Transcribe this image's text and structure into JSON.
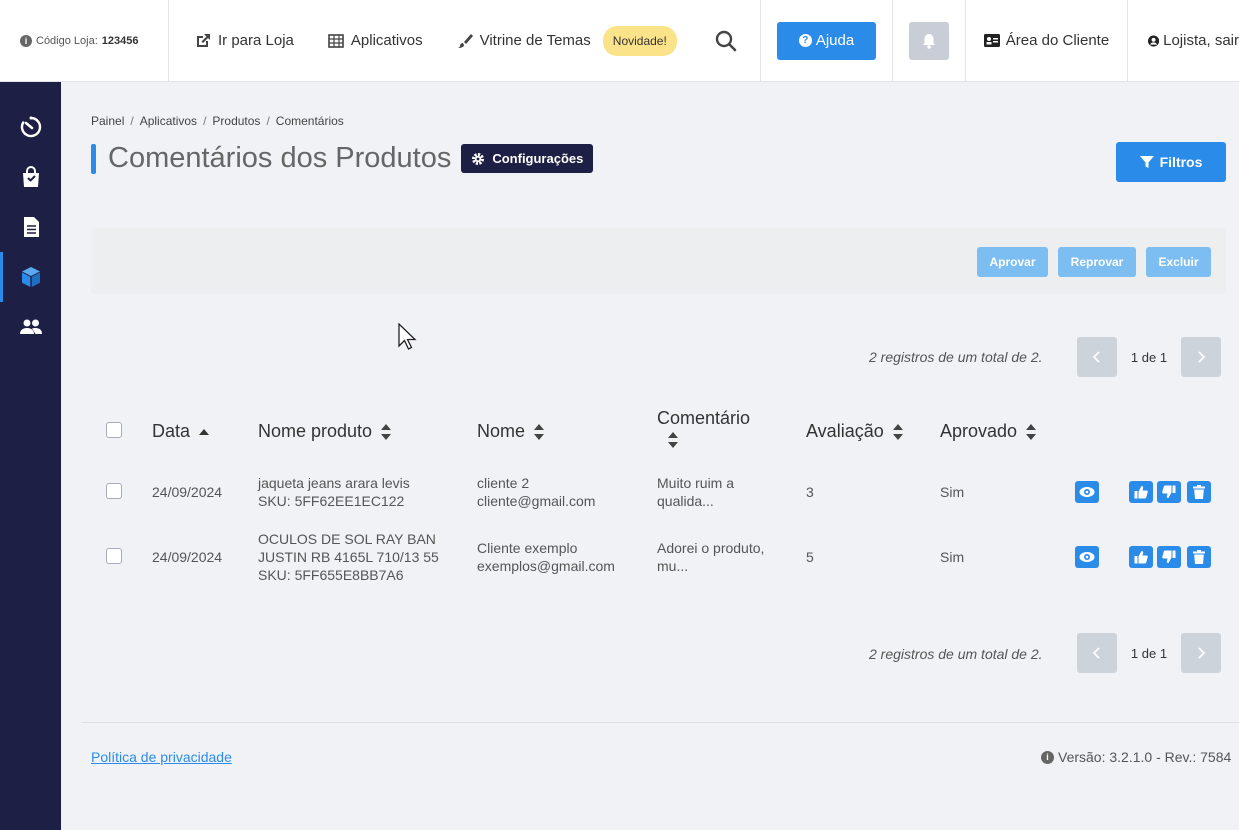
{
  "topbar": {
    "store_code_label": "Código Loja:",
    "store_code_value": "123456",
    "nav": [
      {
        "label": "Ir para Loja",
        "icon": "external-link-icon"
      },
      {
        "label": "Aplicativos",
        "icon": "grid-icon"
      },
      {
        "label": "Vitrine de Temas",
        "icon": "brush-icon"
      }
    ],
    "badge_new": "Novidade!",
    "help_label": "Ajuda",
    "client_area_label": "Área do Cliente",
    "user_label": "Lojista, sair"
  },
  "sidebar": {
    "items": [
      {
        "icon": "dashboard-timer-icon",
        "active": false
      },
      {
        "icon": "shopping-bag-icon",
        "active": false
      },
      {
        "icon": "document-icon",
        "active": false
      },
      {
        "icon": "cube-icon",
        "active": true
      },
      {
        "icon": "users-icon",
        "active": false
      }
    ]
  },
  "breadcrumb": [
    "Painel",
    "Aplicativos",
    "Produtos",
    "Comentários"
  ],
  "page": {
    "title": "Comentários dos Produtos",
    "config_label": "Configurações",
    "filters_label": "Filtros"
  },
  "actions": {
    "approve": "Aprovar",
    "reject": "Reprovar",
    "delete": "Excluir"
  },
  "pagination": {
    "records_text": "2 registros de um total de 2.",
    "page_label": "1 de 1"
  },
  "table": {
    "headers": {
      "date": "Data",
      "product": "Nome produto",
      "name": "Nome",
      "comment": "Comentário",
      "rating": "Avaliação",
      "approved": "Aprovado"
    },
    "rows": [
      {
        "date": "24/09/2024",
        "product": "jaqueta jeans arara levis",
        "sku": "SKU: 5FF62EE1EC122",
        "name": "cliente 2",
        "email": "cliente@gmail.com",
        "comment1": "Muito ruim a",
        "comment2": "qualida...",
        "rating": "3",
        "approved": "Sim"
      },
      {
        "date": "24/09/2024",
        "product": "OCULOS DE SOL RAY BAN",
        "product2": "JUSTIN RB 4165L 710/13 55",
        "sku": "SKU: 5FF655E8BB7A6",
        "name": "Cliente exemplo",
        "email": "exemplos@gmail.com",
        "comment1": "Adorei o produto,",
        "comment2": "mu...",
        "rating": "5",
        "approved": "Sim"
      }
    ]
  },
  "footer": {
    "privacy": "Política de privacidade",
    "version": "Versão: 3.2.1.0 - Rev.: 7584"
  }
}
